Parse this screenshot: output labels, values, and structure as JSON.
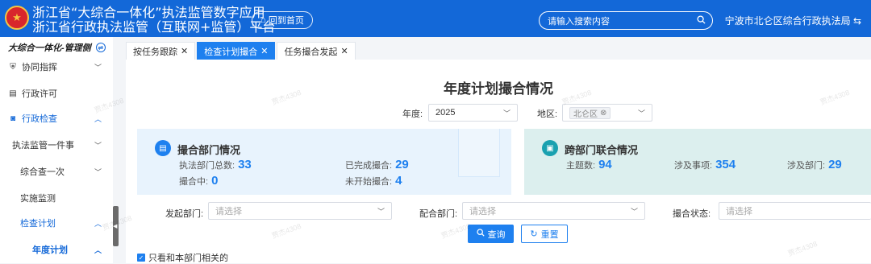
{
  "header": {
    "title_line1": "浙江省“大综合一体化”执法监管数字应用",
    "title_line2": "浙江省行政执法监管（互联网+监管）平台",
    "home_button": "回到首页",
    "search_placeholder": "请输入搜索内容",
    "org_name": "宁波市北仑区综合行政执法局",
    "org_arrow": "⇆"
  },
  "sidebar": {
    "heading": "大综合一体化-管理侧",
    "items": [
      {
        "label": "协同指挥"
      },
      {
        "label": "行政许可"
      },
      {
        "label": "行政检查"
      },
      {
        "label": "执法监管一件事"
      },
      {
        "label": "综合查一次"
      },
      {
        "label": "实施监测"
      },
      {
        "label": "检查计划"
      },
      {
        "label": "年度计划"
      }
    ]
  },
  "tabs": [
    {
      "label": "按任务跟踪"
    },
    {
      "label": "检查计划撮合"
    },
    {
      "label": "任务撮合发起"
    }
  ],
  "main": {
    "title": "年度计划撮合情况",
    "year_label": "年度:",
    "year_value": "2025",
    "region_label": "地区:",
    "region_tag": "北仑区",
    "card1": {
      "title": "撮合部门情况",
      "stats": [
        {
          "label": "执法部门总数:",
          "value": "33"
        },
        {
          "label": "已完成撮合:",
          "value": "29"
        },
        {
          "label": "撮合中:",
          "value": "0"
        },
        {
          "label": "未开始撮合:",
          "value": "4"
        }
      ]
    },
    "card2": {
      "title": "跨部门联合情况",
      "stats": [
        {
          "label": "主题数:",
          "value": "94"
        },
        {
          "label": "涉及事项:",
          "value": "354"
        },
        {
          "label": "涉及部门:",
          "value": "29"
        }
      ]
    },
    "filters": {
      "initiator_label": "发起部门:",
      "initiator_placeholder": "请选择",
      "partner_label": "配合部门:",
      "partner_placeholder": "请选择",
      "status_label": "撮合状态:",
      "status_placeholder": "请选择"
    },
    "query_button": "查询",
    "reset_button": "重置",
    "checkbox_label": "只看和本部门相关的"
  },
  "watermark": "贾杰4308",
  "colors": {
    "brand": "#1368d8",
    "accent": "#1e80ef"
  }
}
